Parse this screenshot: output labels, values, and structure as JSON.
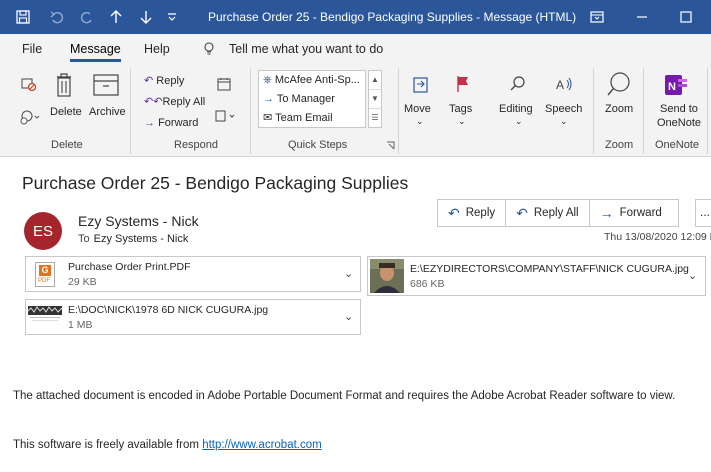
{
  "titlebar": {
    "title": "Purchase Order 25 - Bendigo Packaging Supplies  -  Message (HTML)",
    "save_icon": "save-icon",
    "undo_icon": "undo-icon",
    "redo_icon": "redo-icon",
    "up_icon": "up-arrow-icon",
    "down_icon": "down-arrow-icon",
    "customize_icon": "customize-icon",
    "restore_icon": "ribbon-display-icon",
    "minimize_icon": "minimize-icon",
    "maximize_icon": "maximize-icon",
    "accent": "#2b579a"
  },
  "menu": {
    "file": "File",
    "message": "Message",
    "help": "Help",
    "tell_me": "Tell me what you want to do"
  },
  "ribbon": {
    "delete": {
      "delete_label": "Delete",
      "archive_label": "Archive",
      "group": "Delete"
    },
    "respond": {
      "reply": "Reply",
      "reply_all": "Reply All",
      "forward": "Forward",
      "group": "Respond"
    },
    "quick_steps": {
      "items": [
        "McAfee Anti-Sp...",
        "To Manager",
        "Team Email"
      ],
      "group": "Quick Steps"
    },
    "move": "Move",
    "tags": "Tags",
    "editing": "Editing",
    "speech": "Speech",
    "zoom": {
      "label": "Zoom",
      "group": "Zoom"
    },
    "onenote": {
      "label_line1": "Send to",
      "label_line2": "OneNote",
      "group": "OneNote"
    }
  },
  "message": {
    "subject": "Purchase Order 25 - Bendigo Packaging Supplies",
    "avatar_initials": "ES",
    "avatar_color": "#a4262c",
    "sender": "Ezy Systems - Nick",
    "to_label": "To",
    "to_value": "Ezy Systems - Nick",
    "date": "Thu 13/08/2020 12:09 P",
    "actions": {
      "reply": "Reply",
      "reply_all": "Reply All",
      "forward": "Forward",
      "more": "..."
    }
  },
  "attachments": [
    {
      "name": "Purchase Order Print.PDF",
      "size": "29 KB",
      "icon": "pdf-file-icon"
    },
    {
      "name": "E:\\EZYDIRECTORS\\COMPANY\\STAFF\\NICK CUGURA.jpg",
      "size": "686 KB",
      "icon": "photo-thumbnail"
    },
    {
      "name": "E:\\DOC\\NICK\\1978 6D NICK CUGURA.jpg",
      "size": "1 MB",
      "icon": "photo-thumbnail"
    }
  ],
  "body": {
    "paragraph1": "The attached document is encoded in Adobe Portable Document Format and requires the Adobe Acrobat Reader software to view.",
    "paragraph2_prefix": "This software is freely available from ",
    "link": "http://www.acrobat.com"
  }
}
